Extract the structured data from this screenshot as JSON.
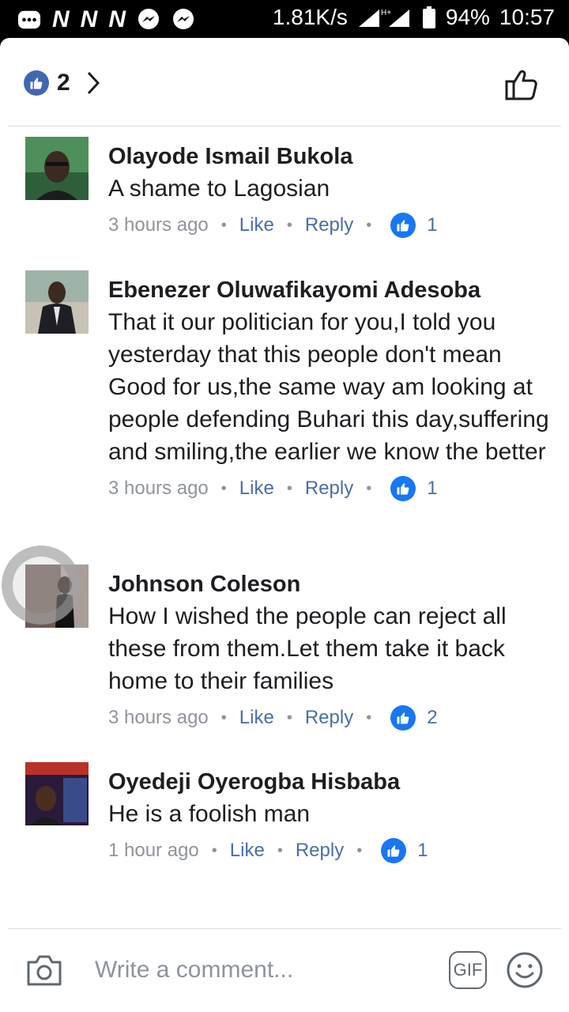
{
  "status_bar": {
    "net_speed": "1.81K/s",
    "battery": "94%",
    "time": "10:57",
    "n_glyph": "N"
  },
  "reactions": {
    "count": "2",
    "badge_color": "#4267b2"
  },
  "comments": [
    {
      "name": "Olayode Ismail Bukola",
      "text": "A shame to Lagosian",
      "time": "3 hours ago",
      "like_label": "Like",
      "reply_label": "Reply",
      "reaction_count": "1",
      "avatar_icon": "profile-photo"
    },
    {
      "name": "Ebenezer Oluwafikayomi Adesoba",
      "text": "That it our politician for you,I told you yesterday that this people don't mean Good for us,the same way am looking at people defending Buhari this day,suffering and smiling,the earlier we know the better",
      "time": "3 hours ago",
      "like_label": "Like",
      "reply_label": "Reply",
      "reaction_count": "1",
      "avatar_icon": "profile-photo"
    },
    {
      "name": "Johnson Coleson",
      "text": "How I wished the people can reject all these from them.Let them take it back home to their families",
      "time": "3 hours ago",
      "like_label": "Like",
      "reply_label": "Reply",
      "reaction_count": "2",
      "avatar_icon": "profile-photo"
    },
    {
      "name": "Oyedeji Oyerogba Hisbaba",
      "text": "He is a foolish man",
      "time": "1 hour ago",
      "like_label": "Like",
      "reply_label": "Reply",
      "reaction_count": "1",
      "avatar_icon": "profile-photo"
    }
  ],
  "composer": {
    "placeholder": "Write a comment...",
    "gif_label": "GIF"
  },
  "colors": {
    "link": "#4b6fa5",
    "like_blue": "#1877f2",
    "text": "#1c1e21",
    "muted": "#90949c"
  }
}
